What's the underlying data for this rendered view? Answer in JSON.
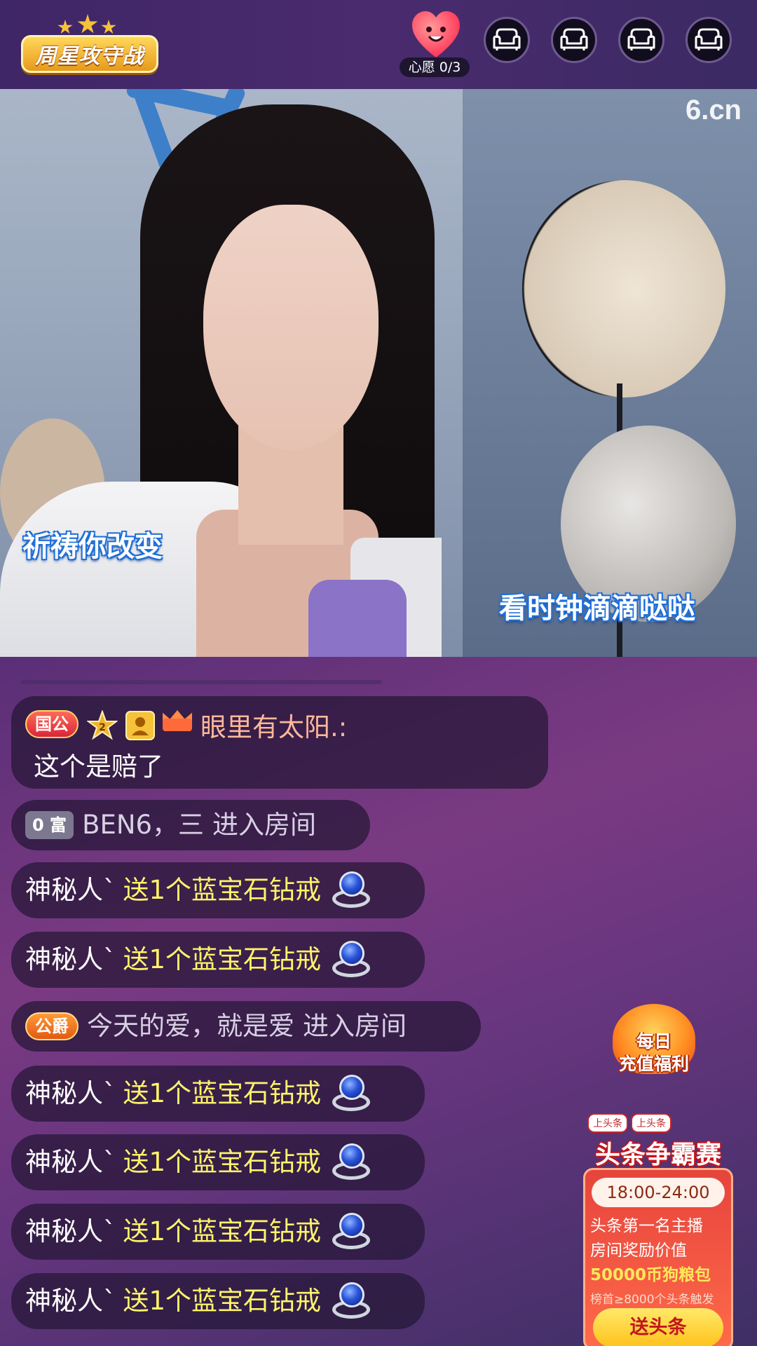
{
  "topbar": {
    "logo_text": "周星攻守战",
    "wish_label": "心愿 0/3",
    "seats": [
      "seat-icon",
      "seat-icon",
      "seat-icon",
      "seat-icon"
    ]
  },
  "video": {
    "watermark": "6.cn",
    "lyric_left": "祈祷你改变",
    "lyric_right": "看时钟滴滴哒哒"
  },
  "chat": {
    "messages": [
      {
        "badge": "国公",
        "nick": "眼里有太阳.:",
        "text": "这个是赔了"
      },
      {
        "badge": "0 富",
        "nick": "BEN6，三",
        "text": "进入房间"
      },
      {
        "nick": "神秘人`",
        "text": "送1个蓝宝石钻戒"
      },
      {
        "nick": "神秘人`",
        "text": "送1个蓝宝石钻戒"
      },
      {
        "badge": "公爵",
        "nick": "今天的爱，就是爱",
        "text": "进入房间"
      },
      {
        "nick": "神秘人`",
        "text": "送1个蓝宝石钻戒"
      },
      {
        "nick": "神秘人`",
        "text": "送1个蓝宝石钻戒"
      },
      {
        "nick": "神秘人`",
        "text": "送1个蓝宝石钻戒"
      },
      {
        "nick": "神秘人`",
        "text": "送1个蓝宝石钻戒"
      }
    ],
    "level_number": "2"
  },
  "promos": {
    "daily_line1": "每日",
    "daily_line2": "充值福利",
    "headline_tag1": "上头条",
    "headline_tag2": "上头条",
    "headline_title": "头条争霸赛",
    "headline_time": "18:00-24:00",
    "headline_desc1": "头条第一名主播",
    "headline_desc2": "房间奖励价值",
    "headline_prize": "50000币狗粮包",
    "headline_note": "榜首≥8000个头条触发",
    "headline_button": "送头条"
  }
}
